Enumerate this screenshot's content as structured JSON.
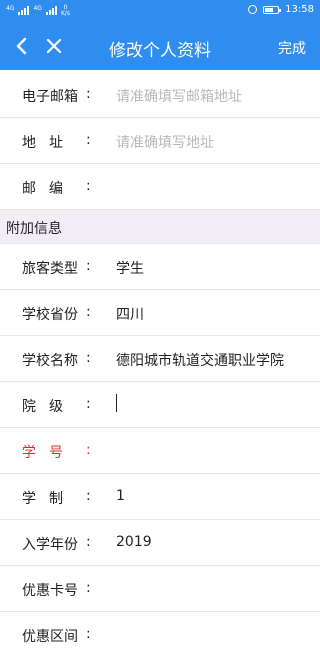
{
  "statusbar": {
    "net1": "4G",
    "net2": "4G",
    "speed_value": "0",
    "speed_unit": "K/s",
    "battery_percent": 0.6,
    "time": "13:58"
  },
  "navbar": {
    "title": "修改个人资料",
    "done_label": "完成",
    "accent_color": "#2f8df0"
  },
  "fields_top": [
    {
      "label": "电子邮箱",
      "colon": ":",
      "value": "请准确填写邮箱地址",
      "placeholder": true
    },
    {
      "label": "地址",
      "colon": ":",
      "value": "请准确填写地址",
      "placeholder": true
    },
    {
      "label": "邮编",
      "colon": ":",
      "value": "",
      "placeholder": true
    }
  ],
  "section": {
    "title": "附加信息"
  },
  "fields_extra": [
    {
      "label": "旅客类型",
      "colon": ":",
      "value": "学生"
    },
    {
      "label": "学校省份",
      "colon": ":",
      "value": "四川"
    },
    {
      "label": "学校名称",
      "colon": ":",
      "value": "德阳城市轨道交通职业学院"
    },
    {
      "label": "院级",
      "colon": ":",
      "value": ""
    },
    {
      "label": "学号",
      "colon": ":",
      "value": "",
      "required": true
    },
    {
      "label": "学制",
      "colon": ":",
      "value": "1"
    },
    {
      "label": "入学年份",
      "colon": ":",
      "value": "2019"
    },
    {
      "label": "优惠卡号",
      "colon": ":",
      "value": ""
    },
    {
      "label": "优惠区间",
      "colon": ":",
      "value": ""
    }
  ]
}
